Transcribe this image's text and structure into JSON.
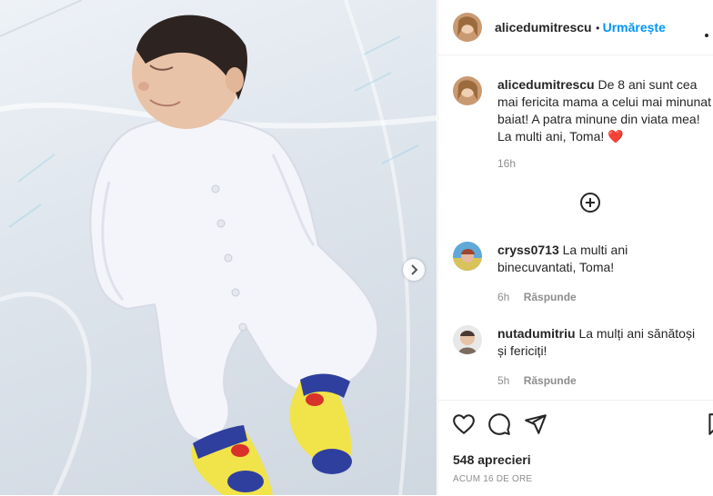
{
  "post": {
    "username": "alicedumitrescu",
    "follow_label": "Urmărește",
    "more_icon": "more-horizontal-icon",
    "caption": "De 8 ani sunt cea mai fericita mama a celui mai minunat baiat! A patra minune din viata mea! La multi ani, Toma!",
    "caption_emoji": "❤️",
    "caption_time": "16h",
    "load_more_icon": "plus-circle-icon",
    "likes": "548 aprecieri",
    "posted_ago": "ACUM 16 DE ORE"
  },
  "comments": [
    {
      "username": "cryss0713",
      "text": "La multi ani binecuvantati, Toma!",
      "time": "6h",
      "reply_label": "Răspunde"
    },
    {
      "username": "nutadumitriu",
      "text": "La mulți ani sănătoși și fericiți!",
      "time": "5h",
      "reply_label": "Răspunde"
    }
  ],
  "icons": {
    "like": "heart-icon",
    "comment": "comment-icon",
    "share": "send-icon",
    "save": "bookmark-icon",
    "next": "chevron-right-icon"
  },
  "colors": {
    "follow_blue": "#0095f6",
    "heart_red": "#ed4956",
    "muted": "#8e8e8e"
  }
}
